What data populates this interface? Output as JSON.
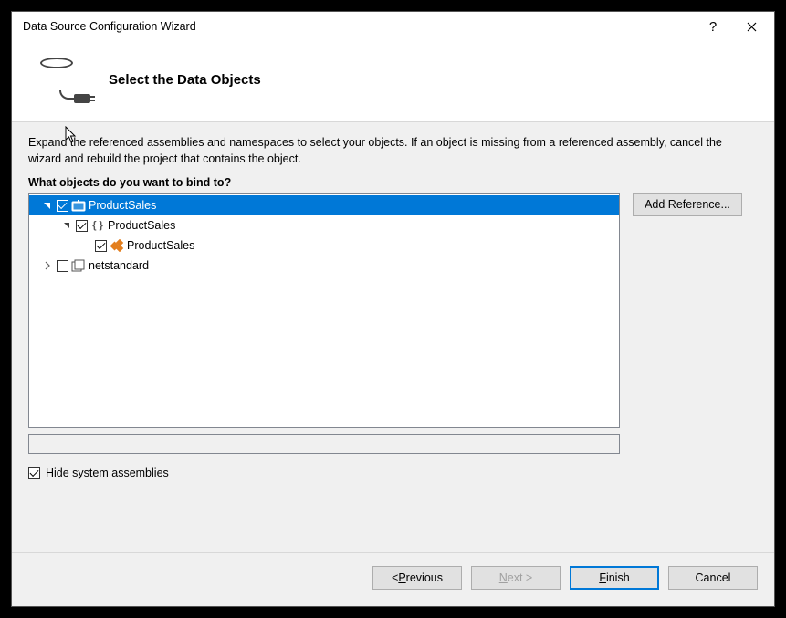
{
  "titlebar": {
    "title": "Data Source Configuration Wizard",
    "help_tooltip": "Help",
    "close_tooltip": "Close"
  },
  "header": {
    "heading": "Select the Data Objects",
    "icon": "database-plug-icon"
  },
  "body": {
    "instructions": "Expand the referenced assemblies and namespaces to select your objects. If an object is missing from a referenced assembly, cancel the wizard and rebuild the project that contains the object.",
    "question": "What objects do you want to bind to?",
    "add_reference_label": "Add Reference...",
    "hide_system_label": "Hide system assemblies",
    "hide_system_checked": true,
    "tree": [
      {
        "id": "productsales_asm",
        "label": "ProductSales",
        "icon": "project-icon",
        "depth": 0,
        "expanded": true,
        "checked": true,
        "selected": true
      },
      {
        "id": "productsales_ns",
        "label": "ProductSales",
        "icon": "namespace-icon",
        "depth": 1,
        "expanded": true,
        "checked": true,
        "selected": false
      },
      {
        "id": "productsales_cls",
        "label": "ProductSales",
        "icon": "class-icon",
        "depth": 2,
        "expanded": null,
        "checked": true,
        "selected": false
      },
      {
        "id": "netstandard",
        "label": "netstandard",
        "icon": "assembly-icon",
        "depth": 0,
        "expanded": false,
        "checked": false,
        "selected": false
      }
    ]
  },
  "footer": {
    "previous": "Previous",
    "next": "Next >",
    "next_disabled": true,
    "finish": "Finish",
    "cancel": "Cancel"
  },
  "colors": {
    "selection": "#0078d7",
    "body_bg": "#f0f0f0",
    "border": "#828790"
  }
}
